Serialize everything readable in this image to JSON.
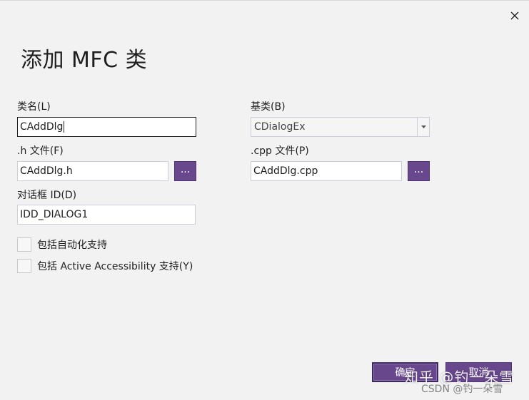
{
  "dialog": {
    "title": "添加 MFC 类"
  },
  "fields": {
    "class_name": {
      "label": "类名(L)",
      "value": "CAddDlg"
    },
    "base_class": {
      "label": "基类(B)",
      "value": "CDialogEx"
    },
    "h_file": {
      "label": ".h 文件(F)",
      "value": "CAddDlg.h",
      "browse_label": "..."
    },
    "cpp_file": {
      "label": ".cpp 文件(P)",
      "value": "CAddDlg.cpp",
      "browse_label": "..."
    },
    "dialog_id": {
      "label": "对话框 ID(D)",
      "value": "IDD_DIALOG1"
    }
  },
  "options": {
    "automation": {
      "label": "包括自动化支持",
      "checked": false
    },
    "accessibility": {
      "label": "包括 Active Accessibility 支持(Y)",
      "checked": false
    }
  },
  "buttons": {
    "ok": "确定",
    "cancel": "取消"
  },
  "watermark": {
    "main": "知乎 @钓一朵雪",
    "sub": "CSDN @钓一朵雪"
  },
  "colors": {
    "accent": "#68478d",
    "background": "#f2f2f2"
  }
}
